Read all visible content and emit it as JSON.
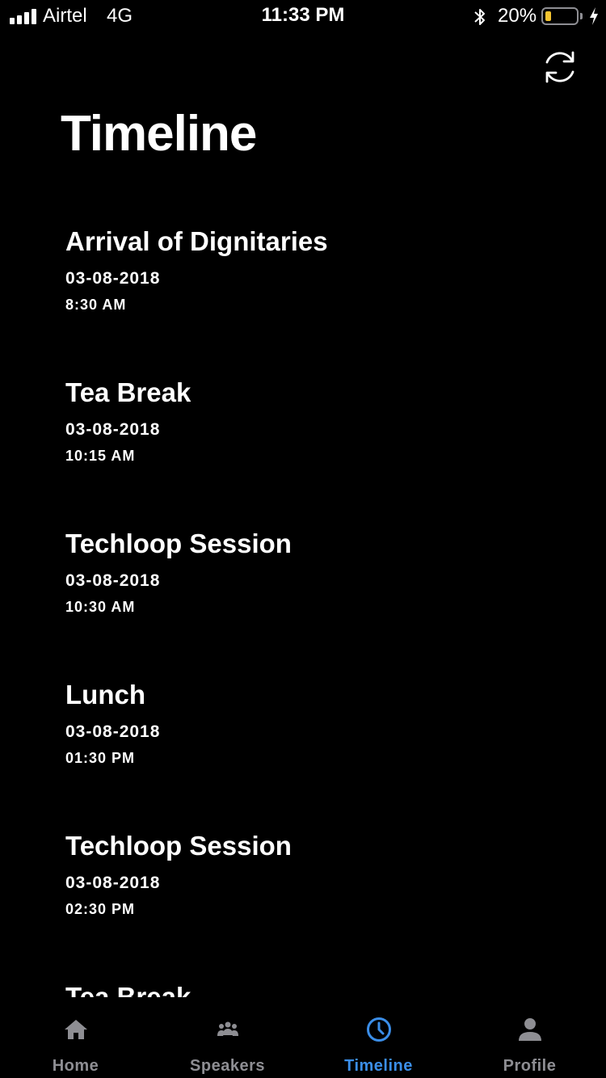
{
  "status_bar": {
    "carrier": "Airtel",
    "network": "4G",
    "time": "11:33 PM",
    "battery_percent": "20%",
    "battery_level": 0.2,
    "battery_color": "#f4c430"
  },
  "header": {
    "title": "Timeline",
    "refresh_icon": "refresh-icon"
  },
  "timeline": {
    "items": [
      {
        "title": "Arrival of Dignitaries",
        "date": "03-08-2018",
        "time": "8:30 AM"
      },
      {
        "title": "Tea Break",
        "date": "03-08-2018",
        "time": "10:15 AM"
      },
      {
        "title": "Techloop Session",
        "date": "03-08-2018",
        "time": "10:30 AM"
      },
      {
        "title": "Lunch",
        "date": "03-08-2018",
        "time": "01:30 PM"
      },
      {
        "title": "Techloop Session",
        "date": "03-08-2018",
        "time": "02:30 PM"
      },
      {
        "title": "Tea Break",
        "date": "",
        "time": ""
      }
    ]
  },
  "tab_bar": {
    "active_color": "#3b8ee8",
    "inactive_color": "#8e8e93",
    "tabs": [
      {
        "label": "Home",
        "icon": "home-icon"
      },
      {
        "label": "Speakers",
        "icon": "people-icon"
      },
      {
        "label": "Timeline",
        "icon": "clock-icon"
      },
      {
        "label": "Profile",
        "icon": "person-icon"
      }
    ],
    "active_tab": "Timeline"
  }
}
